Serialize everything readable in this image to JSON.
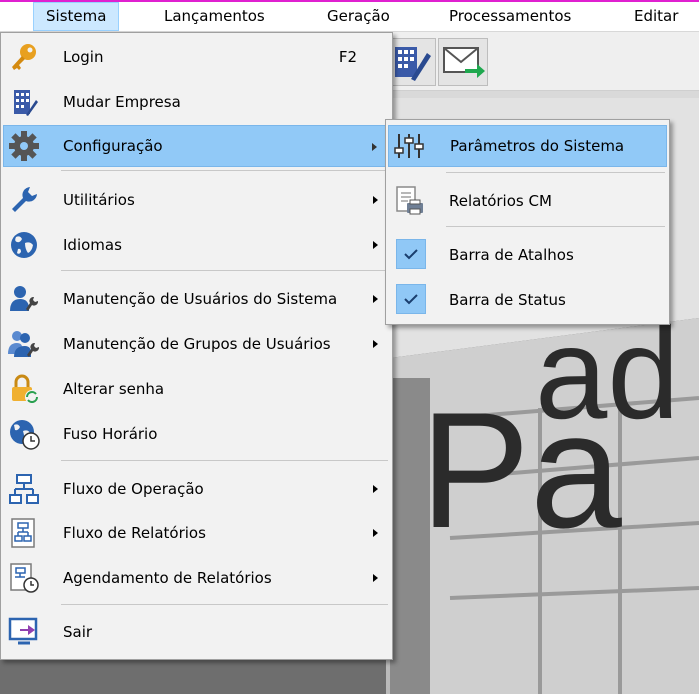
{
  "menubar": {
    "items": [
      {
        "label": "Sistema",
        "active": true
      },
      {
        "label": "Lançamentos"
      },
      {
        "label": "Geração"
      },
      {
        "label": "Processamentos"
      },
      {
        "label": "Editar"
      }
    ]
  },
  "main_menu": {
    "items": [
      {
        "label": "Login",
        "shortcut": "F2",
        "icon": "key-icon"
      },
      {
        "label": "Mudar Empresa",
        "icon": "building-icon"
      },
      {
        "label": "Configuração",
        "icon": "gear-icon",
        "submenu": true,
        "highlighted": true
      },
      {
        "label": "Utilitários",
        "icon": "wrench-icon",
        "submenu": true
      },
      {
        "label": "Idiomas",
        "icon": "globe-icon",
        "submenu": true
      },
      {
        "label": "Manutenção de Usuários do Sistema",
        "icon": "user-wrench-icon",
        "submenu": true
      },
      {
        "label": "Manutenção de Grupos de Usuários",
        "icon": "group-wrench-icon",
        "submenu": true
      },
      {
        "label": "Alterar senha",
        "icon": "lock-refresh-icon"
      },
      {
        "label": "Fuso Horário",
        "icon": "globe-clock-icon"
      },
      {
        "label": "Fluxo de Operação",
        "icon": "flowchart-icon",
        "submenu": true
      },
      {
        "label": "Fluxo de Relatórios",
        "icon": "report-flow-icon",
        "submenu": true
      },
      {
        "label": "Agendamento de Relatórios",
        "icon": "report-schedule-icon",
        "submenu": true
      },
      {
        "label": "Sair",
        "icon": "exit-monitor-icon"
      }
    ]
  },
  "sub_menu": {
    "items": [
      {
        "label": "Parâmetros do Sistema",
        "icon": "sliders-icon",
        "highlighted": true
      },
      {
        "label": "Relatórios CM",
        "icon": "report-printer-icon"
      },
      {
        "label": "Barra de Atalhos",
        "checked": true
      },
      {
        "label": "Barra de Status",
        "checked": true
      }
    ]
  },
  "background": {
    "text_ad": "ad",
    "text_p": "Pa"
  },
  "colors": {
    "highlight": "#91c9f7",
    "menubar_active": "#cce8ff",
    "accent_line": "#e020d0"
  }
}
